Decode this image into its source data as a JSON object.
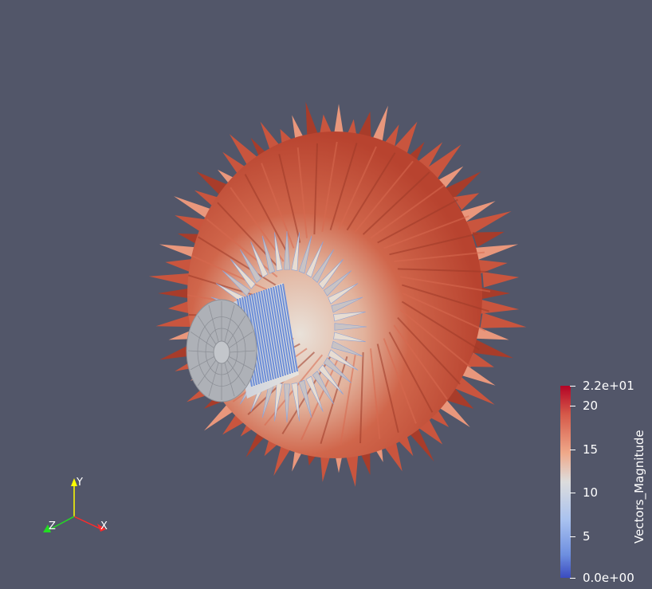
{
  "viewport": {
    "background_color": "#525669"
  },
  "orientation_axes": {
    "x_label": "X",
    "y_label": "Y",
    "z_label": "Z",
    "x_color": "#ff0000",
    "y_color": "#ffff00",
    "z_color": "#00cc00"
  },
  "scalar_bar": {
    "title": "Vectors_Magnitude",
    "colormap": "Cool to Warm",
    "range_min": 0,
    "range_max": 22,
    "low_color": "#3b4cc0",
    "mid_color": "#dddddd",
    "high_color": "#b40426",
    "labels": {
      "max": "2.2e+01",
      "v20": "20",
      "v15": "15",
      "v10": "10",
      "v5": "5",
      "min": "0.0e+00"
    }
  },
  "scene": {
    "object_icon": "glyph-arrows-turbine",
    "hub_color": "#a6a9ae",
    "blade_color_outer": "#c6533c",
    "blade_color_inner": "#e8d4c6",
    "arrow_color_inner": "#6e8fd8"
  }
}
